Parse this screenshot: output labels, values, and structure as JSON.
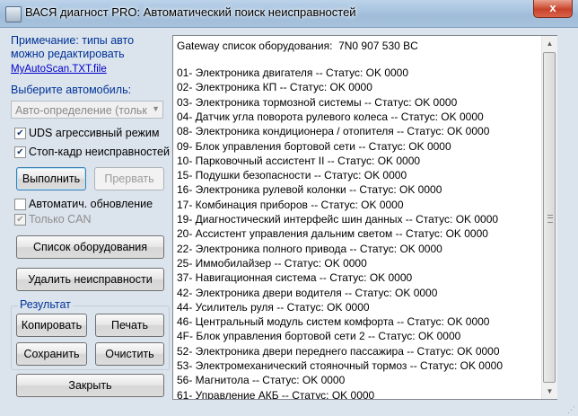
{
  "window": {
    "title": "ВАСЯ диагност PRO:  Автоматический поиск неисправностей",
    "close_glyph": "x"
  },
  "left": {
    "note": "Примечание: типы авто можно редактировать",
    "note_link": "MyAutoScan.TXT.file",
    "select_label": "Выберите автомобиль:",
    "car_select": {
      "value": "Авто-определение (тольк"
    },
    "uds": {
      "label": "UDS агрессивный режим",
      "checked": true
    },
    "freeze": {
      "label": "Стоп-кадр неисправностей",
      "checked": true
    },
    "run_button": "Выполнить",
    "abort_button": "Прервать",
    "auto_update": {
      "label": "Автоматич. обновление",
      "checked": false
    },
    "can_only": {
      "label": "Только CAN",
      "checked": true,
      "disabled": true
    },
    "equipment_button": "Список оборудования",
    "clear_faults_button": "Удалить неисправности",
    "result_group": "Результат",
    "copy_button": "Копировать",
    "print_button": "Печать",
    "save_button": "Сохранить",
    "clean_button": "Очистить",
    "close_button": "Закрыть"
  },
  "results": {
    "header": "Gateway список оборудования:  7N0 907 530 BC",
    "lines": [
      "01- Электроника двигателя -- Статус: OK 0000",
      "02- Электроника КП -- Статус: OK 0000",
      "03- Электроника тормозной системы -- Статус: OK 0000",
      "04- Датчик угла поворота рулевого колеса -- Статус: OK 0000",
      "08- Электроника кондиционера / отопителя -- Статус: OK 0000",
      "09- Блок управления бортовой сети -- Статус: OK 0000",
      "10- Парковочный ассистент II -- Статус: OK 0000",
      "15- Подушки безопасности -- Статус: OK 0000",
      "16- Электроника рулевой колонки -- Статус: OK 0000",
      "17- Комбинация приборов -- Статус: OK 0000",
      "19- Диагностический интерфейс шин данных -- Статус: OK 0000",
      "20- Ассистент управления дальним светом -- Статус: OK 0000",
      "22- Электроника полного привода -- Статус: OK 0000",
      "25- Иммобилайзер -- Статус: OK 0000",
      "37- Навигационная система -- Статус: OK 0000",
      "42- Электроника двери водителя -- Статус: OK 0000",
      "44- Усилитель руля -- Статус: OK 0000",
      "46- Центральный модуль систем комфорта -- Статус: OK 0000",
      "4F- Блок управления бортовой сети 2 -- Статус: OK 0000",
      "52- Электроника двери переднего пассажира -- Статус: OK 0000",
      "53- Электромеханический стояночный тормоз -- Статус: OK 0000",
      "56- Магнитола -- Статус: OK 0000",
      "61- Управление АКБ -- Статус: OK 0000"
    ]
  }
}
